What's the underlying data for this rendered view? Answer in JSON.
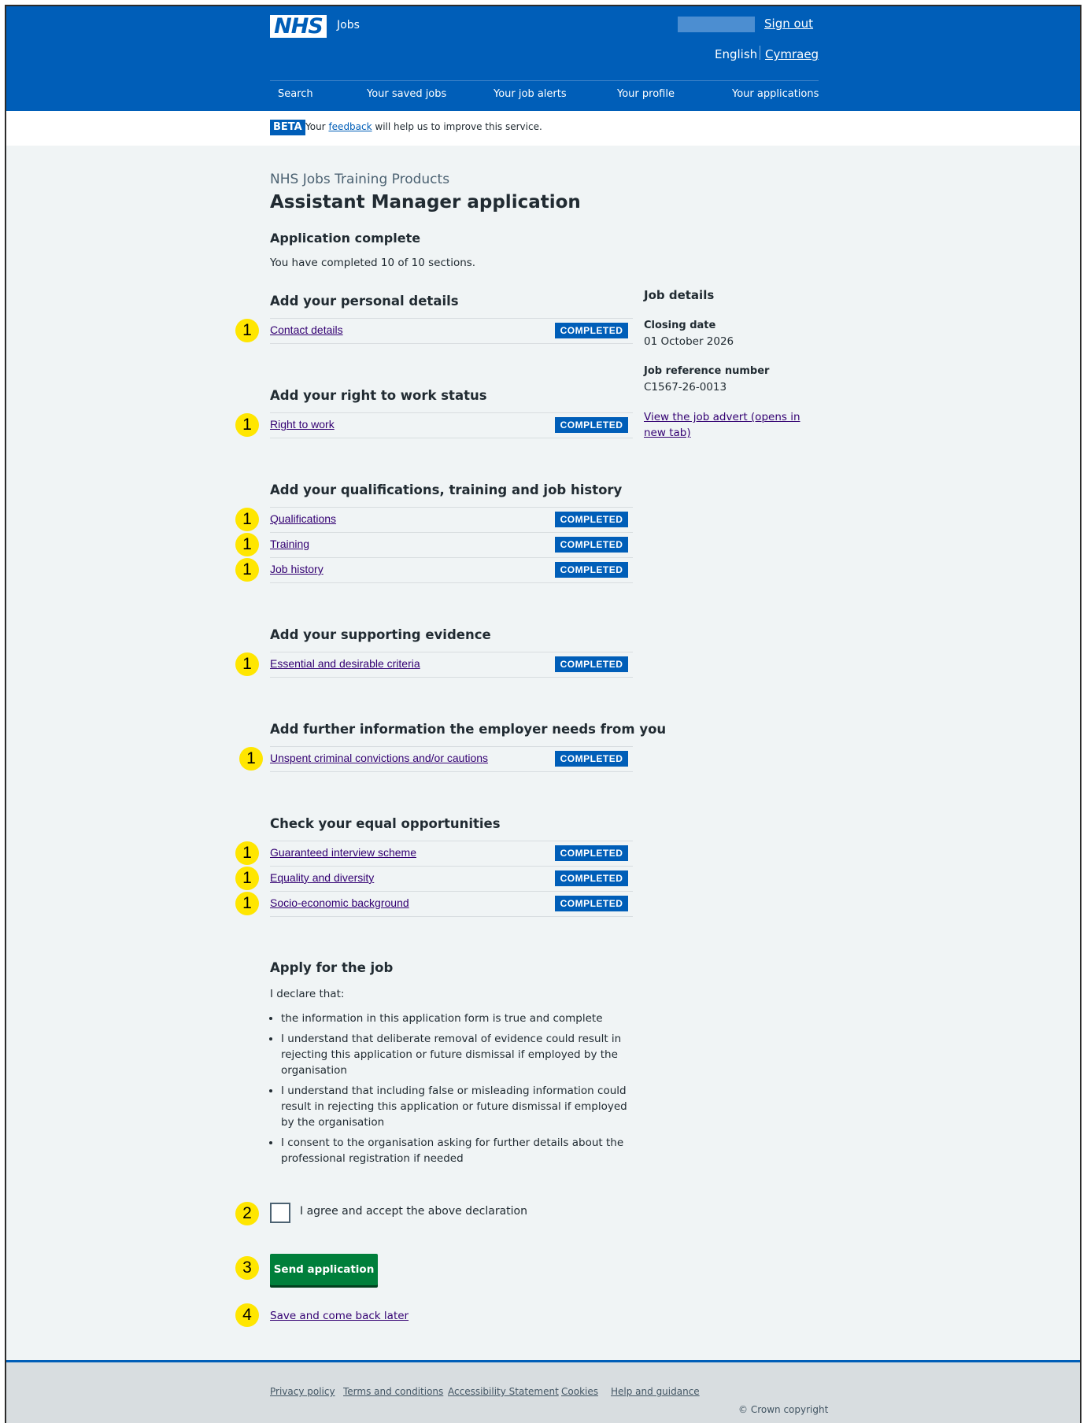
{
  "header": {
    "logo_text": "NHS",
    "service_name": "Jobs",
    "sign_out": "Sign out",
    "lang_english": "English",
    "lang_welsh": "Cymraeg",
    "nav": [
      "Search",
      "Your saved jobs",
      "Your job alerts",
      "Your profile",
      "Your applications"
    ]
  },
  "beta": {
    "tag": "BETA",
    "text_before": "Your",
    "link": "feedback",
    "text_after": "will help us to improve this service."
  },
  "main": {
    "caption": "NHS Jobs Training Products",
    "title": "Assistant Manager application",
    "status_heading": "Application complete",
    "progress_text": "You have completed 10 of 10 sections.",
    "sections": [
      {
        "heading": "Add your personal details",
        "tasks": [
          {
            "label": "Contact details",
            "status": "COMPLETED",
            "marker": "1"
          }
        ]
      },
      {
        "heading": "Add your right to work status",
        "tasks": [
          {
            "label": "Right to work",
            "status": "COMPLETED",
            "marker": "1"
          }
        ]
      },
      {
        "heading": "Add your qualifications, training and job history",
        "tasks": [
          {
            "label": "Qualifications",
            "status": "COMPLETED",
            "marker": "1"
          },
          {
            "label": "Training",
            "status": "COMPLETED",
            "marker": "1"
          },
          {
            "label": "Job history",
            "status": "COMPLETED",
            "marker": "1"
          }
        ]
      },
      {
        "heading": "Add your supporting evidence",
        "tasks": [
          {
            "label": "Essential and desirable criteria",
            "status": "COMPLETED",
            "marker": "1"
          }
        ]
      },
      {
        "heading": "Add further information the employer needs from you",
        "tasks": [
          {
            "label": "Unspent criminal convictions and/or cautions",
            "status": "COMPLETED",
            "marker": "1"
          }
        ]
      },
      {
        "heading": "Check your equal opportunities",
        "tasks": [
          {
            "label": "Guaranteed interview scheme",
            "status": "COMPLETED",
            "marker": "1"
          },
          {
            "label": "Equality and diversity",
            "status": "COMPLETED",
            "marker": "1"
          },
          {
            "label": "Socio-economic background",
            "status": "COMPLETED",
            "marker": "1"
          }
        ]
      }
    ],
    "apply": {
      "heading": "Apply for the job",
      "declare_intro": "I declare that:",
      "bullets": [
        "the information in this application form is true and complete",
        "I understand that deliberate removal of evidence could result in rejecting this application or future dismissal if employed by the organisation",
        "I understand that including false or misleading information could result in rejecting this application or future dismissal if employed by the organisation",
        "I consent to the organisation asking for further details about the professional registration if needed"
      ],
      "checkbox_label": "I agree and accept the above declaration",
      "checkbox_marker": "2",
      "send_button": "Send application",
      "send_marker": "3",
      "save_link": "Save and come back later",
      "save_marker": "4"
    }
  },
  "job_details": {
    "heading": "Job details",
    "closing_label": "Closing date",
    "closing_value": "01 October 2026",
    "ref_label": "Job reference number",
    "ref_value": "C1567-26-0013",
    "advert_link": "View the job advert (opens in new tab)"
  },
  "footer": {
    "links": [
      "Privacy policy",
      "Terms and conditions",
      "Accessibility Statement",
      "Cookies",
      "Help and guidance"
    ],
    "copyright": "© Crown copyright"
  },
  "colors": {
    "nhs_blue": "#005eb8",
    "tag_blue": "#005eb8",
    "button_green": "#007f3b",
    "marker_yellow": "#ffe600",
    "page_bg": "#f0f4f5"
  }
}
